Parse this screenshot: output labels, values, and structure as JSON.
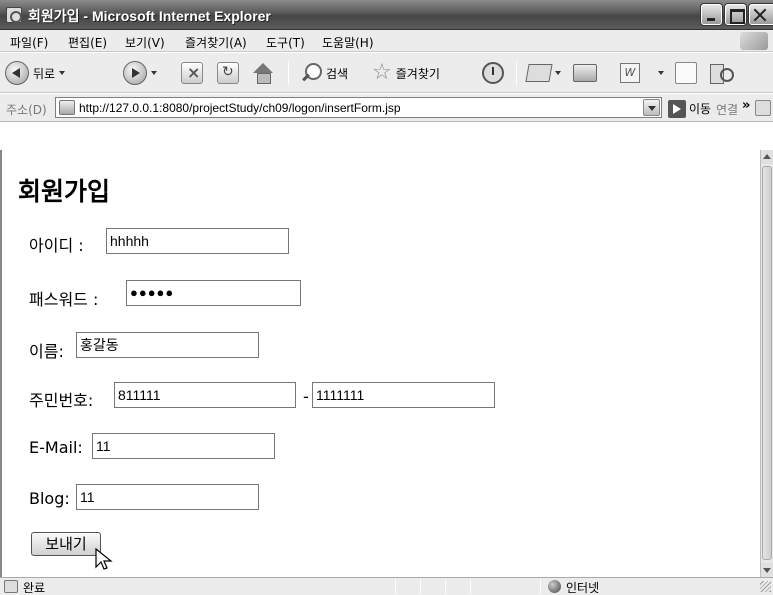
{
  "window": {
    "title": "회원가입 - Microsoft Internet Explorer"
  },
  "menu": {
    "items": [
      {
        "label": "파일(F)"
      },
      {
        "label": "편집(E)"
      },
      {
        "label": "보기(V)"
      },
      {
        "label": "즐겨찾기(A)"
      },
      {
        "label": "도구(T)"
      },
      {
        "label": "도움말(H)"
      }
    ]
  },
  "toolbar": {
    "back_label": "뒤로",
    "search_label": "검색",
    "favorites_label": "즐겨찾기"
  },
  "address": {
    "label": "주소(D)",
    "url": "http://127.0.0.1:8080/projectStudy/ch09/logon/insertForm.jsp",
    "go_label": "이동",
    "links_label": "연결",
    "links_chevron": "»"
  },
  "form": {
    "heading": "회원가입",
    "id_label": "아이디 :",
    "id_value": "hhhhh",
    "password_label": "패스워드 :",
    "password_value": "●●●●●",
    "name_label": "이름:",
    "name_value": "홍갈동",
    "ssn_label": "주민번호:",
    "ssn_first": "811111",
    "ssn_dash": "-",
    "ssn_second": "1111111",
    "email_label": "E-Mail:",
    "email_value": "11",
    "blog_label": "Blog:",
    "blog_value": "11",
    "submit_label": "보내기"
  },
  "status": {
    "text": "완료",
    "zone": "인터넷"
  }
}
